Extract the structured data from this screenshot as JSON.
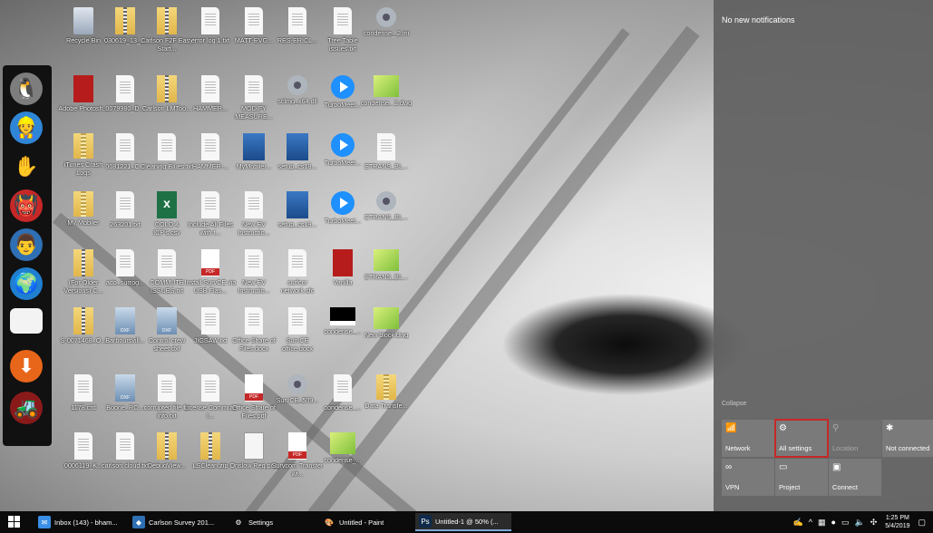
{
  "desktop_icons": [
    {
      "label": "Recycle Bin",
      "icon": "recycle-bin-icon",
      "glyph": "g-recycle"
    },
    {
      "label": "030619_13_...",
      "icon": "folder-zip-icon",
      "glyph": "g-zip"
    },
    {
      "label": "Carlson F2F Easy Start...",
      "icon": "folder-zip-icon",
      "glyph": "g-zip"
    },
    {
      "label": "error log 1.txt",
      "icon": "text-file-icon",
      "glyph": "g-doc"
    },
    {
      "label": "MATT-EVG...",
      "icon": "text-file-icon",
      "glyph": "g-doc"
    },
    {
      "label": "RES-ERICL...",
      "icon": "text-file-icon",
      "glyph": "g-doc"
    },
    {
      "label": "Tree Table issues.txt",
      "icon": "text-file-icon",
      "glyph": "g-doc"
    },
    {
      "label": "condense_ 2.ini",
      "icon": "settings-file-icon",
      "glyph": "g-gear"
    },
    {
      "label": "Adobe Photosh...",
      "icon": "adobe-icon",
      "glyph": "g-adobe"
    },
    {
      "label": "0079980_D...",
      "icon": "text-file-icon",
      "glyph": "g-doc"
    },
    {
      "label": "Carlson LMToo...",
      "icon": "folder-zip-icon",
      "glyph": "g-zip"
    },
    {
      "label": "HAMMER...",
      "icon": "text-file-icon",
      "glyph": "g-doc"
    },
    {
      "label": "MODIFY MEASURE...",
      "icon": "text-file-icon",
      "glyph": "g-doc"
    },
    {
      "label": "sclmg_x64.dll",
      "icon": "dll-file-icon",
      "glyph": "g-gear"
    },
    {
      "label": "TurboMeet...",
      "icon": "turbomeeting-icon",
      "glyph": "g-turbo"
    },
    {
      "label": "condense_ 2.dwg",
      "icon": "dwg-file-icon",
      "glyph": "g-map"
    },
    {
      "label": "iTunes Crash Logs",
      "icon": "folder-icon",
      "glyph": "g-folder"
    },
    {
      "label": "0081221_C...",
      "icon": "text-file-icon",
      "glyph": "g-doc"
    },
    {
      "label": "Cleaning Blues.txt",
      "icon": "text-file-icon",
      "glyph": "g-doc"
    },
    {
      "label": "HAMMER-...",
      "icon": "text-file-icon",
      "glyph": "g-doc"
    },
    {
      "label": "MyMobiler...",
      "icon": "installer-icon",
      "glyph": "g-app"
    },
    {
      "label": "setup_cs18...",
      "icon": "setup-icon",
      "glyph": "g-app"
    },
    {
      "label": "TurboMeet...",
      "icon": "turbomeeting-icon",
      "glyph": "g-turbo"
    },
    {
      "label": "ETRANS_BL...",
      "icon": "text-file-icon",
      "glyph": "g-doc"
    },
    {
      "label": "My Mobiler",
      "icon": "folder-icon",
      "glyph": "g-folder"
    },
    {
      "label": "263201.txt",
      "icon": "text-file-icon",
      "glyph": "g-doc"
    },
    {
      "label": "COLO 4 ICP's.csv",
      "icon": "excel-icon",
      "glyph": "g-excel"
    },
    {
      "label": "Include All Files with t...",
      "icon": "text-file-icon",
      "glyph": "g-doc"
    },
    {
      "label": "New EV Instructio...",
      "icon": "word-doc-icon",
      "glyph": "g-doc"
    },
    {
      "label": "setup_cs19...",
      "icon": "setup-icon",
      "glyph": "g-app"
    },
    {
      "label": "TurboMeet...",
      "icon": "turbomeeting-icon",
      "glyph": "g-turbo"
    },
    {
      "label": "ETRANS_BL...",
      "icon": "settings-file-icon",
      "glyph": "g-gear"
    },
    {
      "label": "(For Older Versions) C...",
      "icon": "folder-zip-icon",
      "glyph": "g-zip"
    },
    {
      "label": "ado_surrog...",
      "icon": "text-file-icon",
      "glyph": "g-doc"
    },
    {
      "label": "COMMUTE ISSUES.txt",
      "icon": "text-file-icon",
      "glyph": "g-doc"
    },
    {
      "label": "Install SurvCE via USB Flas...",
      "icon": "pdf-icon",
      "glyph": "g-pdf"
    },
    {
      "label": "New EV Instructio...",
      "icon": "word-doc-icon",
      "glyph": "g-doc"
    },
    {
      "label": "surfcor network.sfc",
      "icon": "text-file-icon",
      "glyph": "g-doc"
    },
    {
      "label": "Vanilla",
      "icon": "autocad-icon",
      "glyph": "g-adobe"
    },
    {
      "label": "ETRANS_BL...",
      "icon": "dwg-file-icon",
      "glyph": "g-map"
    },
    {
      "label": "S-0071468_O...",
      "icon": "folder-zip-icon",
      "glyph": "g-zip"
    },
    {
      "label": "Barboursvill...",
      "icon": "dxf-file-icon",
      "glyph": "g-dxf"
    },
    {
      "label": "Control crew sheet.dxf",
      "icon": "dxf-file-icon",
      "glyph": "g-dxf"
    },
    {
      "label": "JIGSAW.txt",
      "icon": "text-file-icon",
      "glyph": "g-doc"
    },
    {
      "label": "Office Share of Files.docx",
      "icon": "word-doc-icon",
      "glyph": "g-doc"
    },
    {
      "label": "SurvCE office.docx",
      "icon": "word-doc-icon",
      "glyph": "g-doc"
    },
    {
      "label": "condense_...",
      "icon": "block-file-icon",
      "glyph": "g-blk"
    },
    {
      "label": "New block.dwg",
      "icon": "dwg-file-icon",
      "glyph": "g-map"
    },
    {
      "label": "1178.crd",
      "icon": "text-file-icon",
      "glyph": "g-doc"
    },
    {
      "label": "Boone_RO...",
      "icon": "dxf-file-icon",
      "glyph": "g-dxf"
    },
    {
      "label": "corrupted file fix info.txt",
      "icon": "text-file-icon",
      "glyph": "g-doc"
    },
    {
      "label": "License Commute I...",
      "icon": "text-file-icon",
      "glyph": "g-doc"
    },
    {
      "label": "Office Share of Files.pdf",
      "icon": "pdf-icon",
      "glyph": "g-pdf"
    },
    {
      "label": "SurvCE_509...",
      "icon": "settings-file-icon",
      "glyph": "g-gear"
    },
    {
      "label": "condense_...",
      "icon": "text-file-icon",
      "glyph": "g-doc"
    },
    {
      "label": "Data Transfe...",
      "icon": "installer-icon",
      "glyph": "g-folder"
    },
    {
      "label": "0006119_K...",
      "icon": "text-file-icon",
      "glyph": "g-doc"
    },
    {
      "label": "carlson cloud.txt",
      "icon": "text-file-icon",
      "glyph": "g-doc"
    },
    {
      "label": "DebugView...",
      "icon": "folder-zip-icon",
      "glyph": "g-zip"
    },
    {
      "label": "LSClean.zip",
      "icon": "folder-zip-icon",
      "glyph": "g-zip"
    },
    {
      "label": "Onslow Reg.png",
      "icon": "image-file-icon",
      "glyph": "g-png"
    },
    {
      "label": "Survcom Transfer wi...",
      "icon": "pdf-icon",
      "glyph": "g-pdf"
    },
    {
      "label": "condense_...",
      "icon": "dwg-file-icon",
      "glyph": "g-map"
    }
  ],
  "dock": [
    {
      "icon": "penguin-icon",
      "glyph": "🐧",
      "bg": "#7d7d7d"
    },
    {
      "icon": "worker-avatar-icon",
      "glyph": "👷",
      "bg": "#2f86d6"
    },
    {
      "icon": "hand-icon",
      "glyph": "✋",
      "bg": "#111111"
    },
    {
      "icon": "monster-icon",
      "glyph": "👹",
      "bg": "#c62828"
    },
    {
      "icon": "engineer-icon",
      "glyph": "👨",
      "bg": "#2f6fb3"
    },
    {
      "icon": "globe-icon",
      "glyph": "🌍",
      "bg": "#1f7fd1"
    },
    {
      "icon": "blank-window-icon",
      "glyph": "",
      "bg": "#f3f3f3"
    },
    {
      "icon": "download-arrow-icon",
      "glyph": "⬇",
      "bg": "#e8661a"
    },
    {
      "icon": "tractor-icon",
      "glyph": "🚜",
      "bg": "#8a1a1a"
    }
  ],
  "action_center": {
    "title": "No new notifications",
    "collapse": "Collapse",
    "tiles": [
      {
        "label": "Network",
        "icon": "network-icon",
        "glyph": "📶",
        "dim": false
      },
      {
        "label": "All settings",
        "icon": "gear-icon",
        "glyph": "⚙",
        "dim": false
      },
      {
        "label": "Location",
        "icon": "location-icon",
        "glyph": "⚲",
        "dim": true
      },
      {
        "label": "Not connected",
        "icon": "bluetooth-icon",
        "glyph": "✱",
        "dim": false
      },
      {
        "label": "VPN",
        "icon": "vpn-icon",
        "glyph": "∞",
        "dim": false
      },
      {
        "label": "Project",
        "icon": "project-icon",
        "glyph": "▭",
        "dim": false
      },
      {
        "label": "Connect",
        "icon": "connect-icon",
        "glyph": "▣",
        "dim": false
      }
    ]
  },
  "taskbar": {
    "items": [
      {
        "label": "Inbox (143) - bham...",
        "icon": "email-app-icon",
        "glyph": "✉",
        "bg": "#3a8ee6",
        "active": false
      },
      {
        "label": "Carlson Survey 201...",
        "icon": "carlson-survey-icon",
        "glyph": "◆",
        "bg": "#2f6fb3",
        "active": false
      },
      {
        "label": "Settings",
        "icon": "gear-icon",
        "glyph": "⚙",
        "bg": "transparent",
        "active": false
      },
      {
        "label": "Untitled - Paint",
        "icon": "paint-icon",
        "glyph": "🎨",
        "bg": "transparent",
        "active": false
      },
      {
        "label": "Untitled-1 @ 50% (...",
        "icon": "photoshop-icon",
        "glyph": "Ps",
        "bg": "#0f2a4a",
        "active": true
      }
    ],
    "tray": {
      "time": "1:25 PM",
      "date": "5/4/2019",
      "icons": [
        {
          "icon": "signature-app-icon",
          "glyph": "✍"
        },
        {
          "icon": "chevron-up-icon",
          "glyph": "^"
        },
        {
          "icon": "tray-app-icon",
          "glyph": "▦"
        },
        {
          "icon": "tray-dot-icon",
          "glyph": "●"
        },
        {
          "icon": "monitor-icon",
          "glyph": "▭"
        },
        {
          "icon": "volume-icon",
          "glyph": "🔈"
        },
        {
          "icon": "network-tray-icon",
          "glyph": "✣"
        }
      ],
      "notifications_glyph": "▢"
    }
  }
}
